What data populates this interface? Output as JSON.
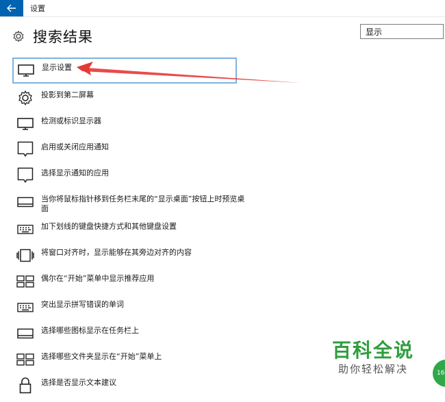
{
  "window": {
    "title": "设置",
    "back_icon": "back-arrow-icon"
  },
  "header": {
    "title": "搜索结果",
    "icon": "gear-icon"
  },
  "search": {
    "value": "显示"
  },
  "results": [
    {
      "label": "显示设置",
      "icon": "monitor-icon",
      "selected": true
    },
    {
      "label": "投影到第二屏幕",
      "icon": "gear-icon"
    },
    {
      "label": "检测或标识显示器",
      "icon": "monitor-icon"
    },
    {
      "label": "启用或关闭应用通知",
      "icon": "speech-bubble-icon"
    },
    {
      "label": "选择显示通知的应用",
      "icon": "speech-bubble-icon"
    },
    {
      "label": "当你将鼠标指针移到任务栏末尾的“显示桌面”按钮上时预览桌面",
      "icon": "taskbar-icon"
    },
    {
      "label": "加下划线的键盘快捷方式和其他键盘设置",
      "icon": "keyboard-icon"
    },
    {
      "label": "将窗口对齐时，显示能够在其旁边对齐的内容",
      "icon": "snap-window-icon"
    },
    {
      "label": "偶尔在“开始”菜单中显示推荐应用",
      "icon": "start-tiles-icon"
    },
    {
      "label": "突出显示拼写错误的单词",
      "icon": "keyboard-icon"
    },
    {
      "label": "选择哪些图标显示在任务栏上",
      "icon": "taskbar-icon"
    },
    {
      "label": "选择哪些文件夹显示在“开始”菜单上",
      "icon": "start-tiles-icon"
    },
    {
      "label": "选择是否显示文本建议",
      "icon": "lock-icon"
    }
  ],
  "watermark": {
    "title": "百科全说",
    "subtitle": "助你轻松解决",
    "badge": "16"
  },
  "colors": {
    "accent": "#0063b1",
    "selection_border": "#7fb2de",
    "arrow": "#e53935",
    "watermark_green": "#2e9e3e"
  }
}
